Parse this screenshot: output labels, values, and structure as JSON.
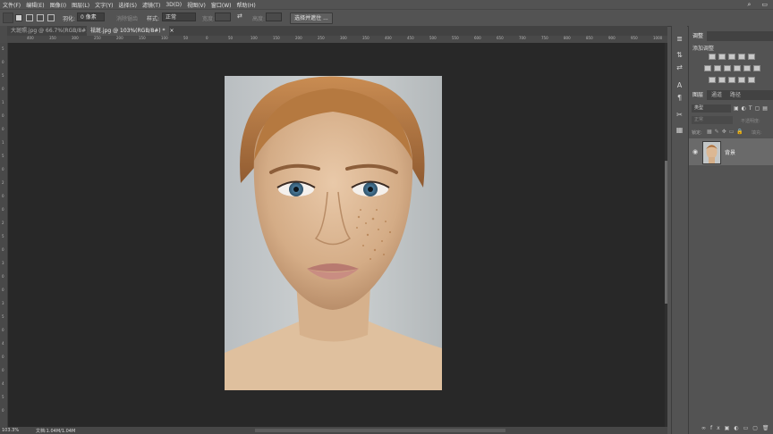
{
  "menu": [
    "文件(F)",
    "编辑(E)",
    "图像(I)",
    "图层(L)",
    "文字(Y)",
    "选择(S)",
    "滤镜(T)",
    "3D(D)",
    "视图(V)",
    "窗口(W)",
    "帮助(H)"
  ],
  "options": {
    "feather_label": "羽化:",
    "feather_value": "0 像素",
    "antialias_label": "消除锯齿",
    "style_label": "样式:",
    "style_value": "正常",
    "width_label": "宽度:",
    "height_label": "高度:",
    "select_mask_button": "选择并遮住 ..."
  },
  "tabs": [
    {
      "label": "大斑照.jpg @ 66.7%(RGB/8#)",
      "active": false
    },
    {
      "label": "祛斑.jpg @ 103%(RGB/8#) *",
      "active": true
    }
  ],
  "ruler_h": [
    "400",
    "350",
    "300",
    "250",
    "200",
    "150",
    "100",
    "50",
    "0",
    "50",
    "100",
    "150",
    "200",
    "250",
    "300",
    "350",
    "400",
    "450",
    "500",
    "550",
    "600",
    "650",
    "700",
    "750",
    "800",
    "850",
    "900",
    "950",
    "1000",
    "1050"
  ],
  "ruler_v": [
    "5",
    "0",
    "5",
    "0",
    "1",
    "0",
    "0",
    "1",
    "5",
    "0",
    "2",
    "0",
    "0",
    "2",
    "5",
    "0",
    "3",
    "0",
    "0",
    "3",
    "5",
    "0",
    "4",
    "0",
    "0",
    "4",
    "5",
    "0"
  ],
  "status": {
    "zoom": "103.3%",
    "doc": "文档:1.04M/1.04M"
  },
  "adjust_panel": {
    "tab": "调整",
    "subtitle": "添加调整"
  },
  "layers_panel": {
    "tabs": [
      "图层",
      "通道",
      "路径"
    ],
    "kind_filter": "类型",
    "blend_mode": "正常",
    "opacity_label": "不透明度:",
    "lock_label": "锁定:",
    "fill_label": "填充:",
    "layer_name": "背景"
  },
  "colors": {
    "ui_bg": "#535353",
    "canvas": "#282828",
    "panel_dark": "#424242"
  }
}
